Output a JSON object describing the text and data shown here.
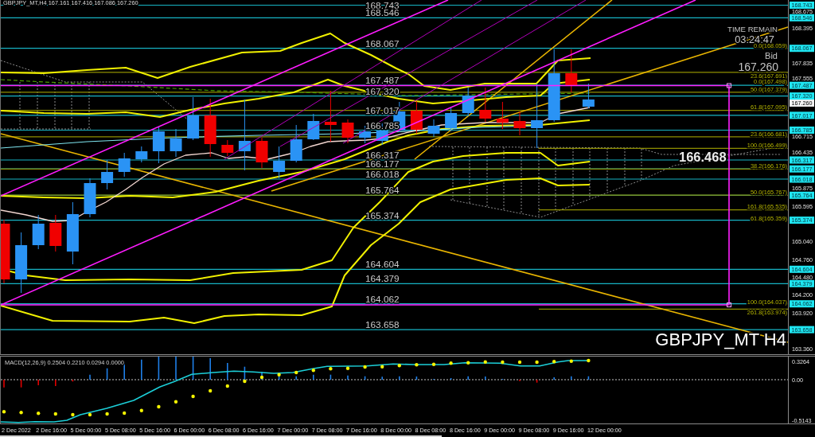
{
  "chart": {
    "title": "GBPJPY_MT,H4  167.161 167.416 167.086 167.260",
    "level_labels": [
      "168.743",
      "168.546",
      "168.067",
      "167.487",
      "167.320",
      "167.017",
      "166.785",
      "166.317",
      "166.177",
      "166.018",
      "165.764",
      "165.374",
      "164.604",
      "164.379",
      "164.062",
      "163.658"
    ],
    "fibonacci_labels": [
      "0.0(168.059)",
      "23.6(167.691)",
      "0.0(167.498)",
      "50.0(167.379)",
      "61.8(167.095)",
      "23.6(166.681)",
      "100.0(166.499)",
      "38.2(166.176)",
      "50.0(165.767)",
      "161.8(165.535)",
      "61.8(165.359)",
      "100.0(164.037)",
      "261.8(163.974)"
    ],
    "countdown": {
      "label": "TIME REMAIN",
      "value": "03:24:47"
    },
    "bid": {
      "label": "Bid",
      "value": "167.260"
    },
    "marker_price": "166.468",
    "symbol_label": "GBPJPY_MT H4"
  },
  "price_axis": {
    "ticks": [
      "168.675",
      "168.395",
      "167.835",
      "167.555",
      "166.715",
      "166.435",
      "165.875",
      "165.595",
      "165.040",
      "164.760",
      "164.480",
      "164.200",
      "163.920",
      "163.360"
    ],
    "level_tags": [
      "168.743",
      "168.546",
      "168.067",
      "167.487",
      "167.320",
      "167.017",
      "166.785",
      "166.317",
      "166.177",
      "166.018",
      "165.764",
      "165.374",
      "164.604",
      "164.379",
      "164.062",
      "163.658"
    ],
    "current_price": "167.260"
  },
  "macd": {
    "title": "MACD(12,26,9) 0.2504 0.2210 0.0294 0.0000",
    "ticks": [
      "0.3264",
      "0.00",
      "-0.5143"
    ]
  },
  "time_axis": {
    "labels": [
      "2 Dec 2022",
      "2 Dec 16:00",
      "5 Dec 00:00",
      "5 Dec 08:00",
      "5 Dec 16:00",
      "6 Dec 00:00",
      "6 Dec 08:00",
      "6 Dec 16:00",
      "7 Dec 00:00",
      "7 Dec 08:00",
      "7 Dec 16:00",
      "8 Dec 00:00",
      "8 Dec 08:00",
      "8 Dec 16:00",
      "9 Dec 00:00",
      "9 Dec 08:00",
      "9 Dec 16:00",
      "12 Dec 00:00"
    ]
  }
}
